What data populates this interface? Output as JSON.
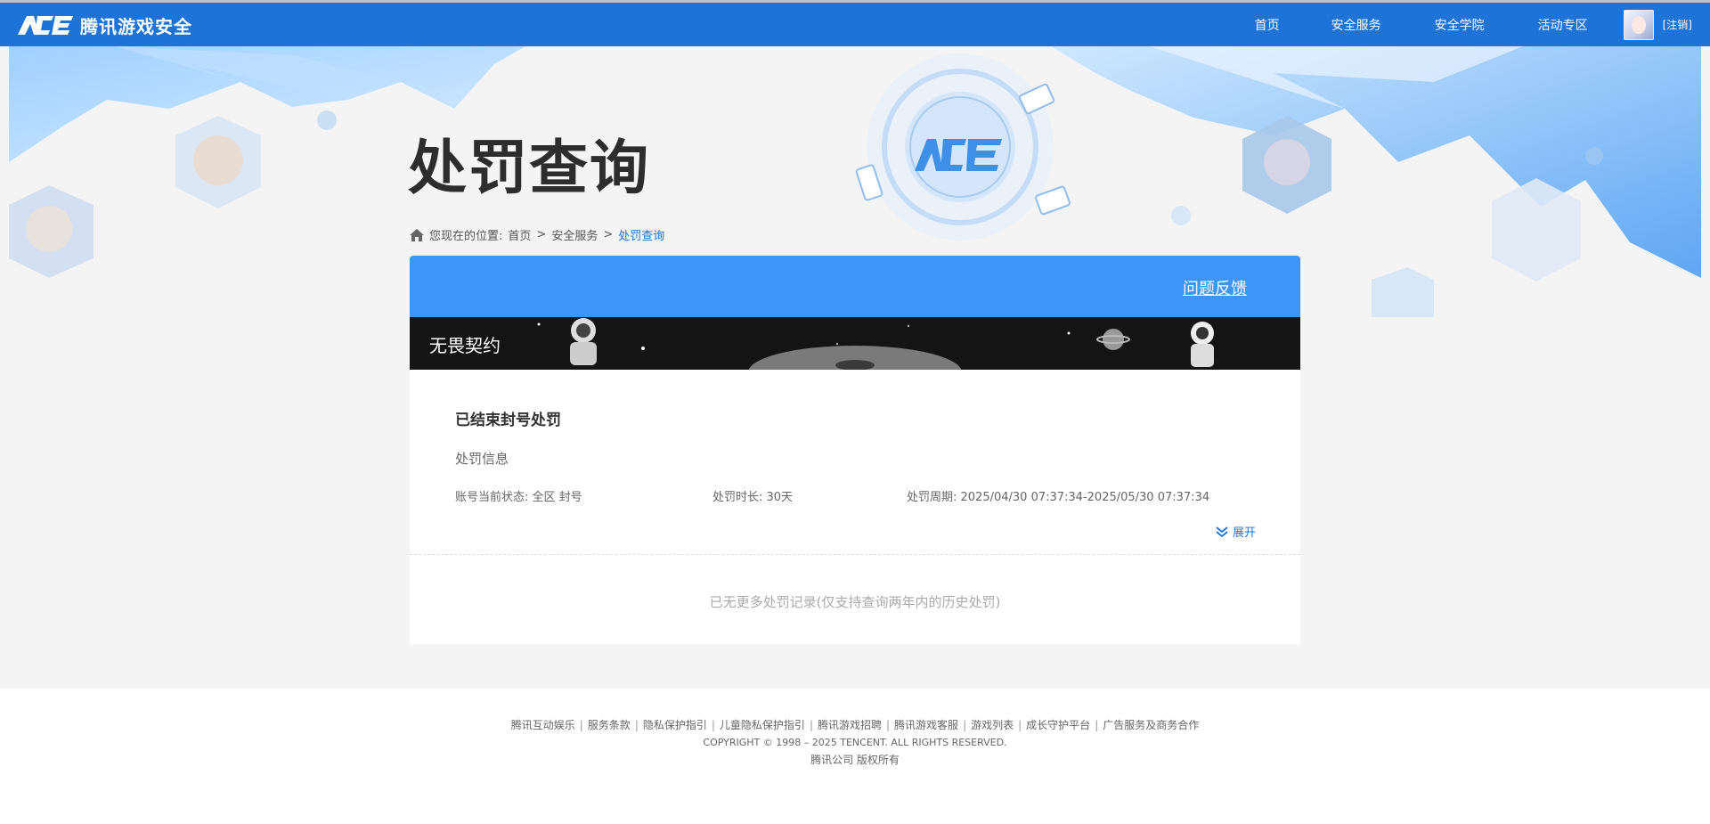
{
  "header": {
    "logo_text": "腾讯游戏安全",
    "nav": [
      "首页",
      "安全服务",
      "安全学院",
      "活动专区"
    ],
    "logout": "[注销]"
  },
  "page_title": "处罚查询",
  "breadcrumb": {
    "prefix": "您现在的位置:",
    "items": [
      "首页",
      "安全服务",
      "处罚查询"
    ],
    "separator": ">"
  },
  "panel": {
    "feedback": "问题反馈",
    "season_title": "无畏契约",
    "record": {
      "title": "已结束封号处罚",
      "subtitle": "处罚信息",
      "status": "账号当前状态: 全区 封号",
      "duration": "处罚时长: 30天",
      "period": "处罚周期: 2025/04/30 07:37:34-2025/05/30 07:37:34",
      "expand": "展开"
    },
    "no_more": "已无更多处罚记录(仅支持查询两年内的历史处罚)"
  },
  "footer": {
    "links": [
      "腾讯互动娱乐",
      "服务条款",
      "隐私保护指引",
      "儿童隐私保护指引",
      "腾讯游戏招聘",
      "腾讯游戏客服",
      "游戏列表",
      "成长守护平台",
      "广告服务及商务合作"
    ],
    "copyright": "COPYRIGHT © 1998 – 2025 TENCENT. ALL RIGHTS RESERVED.",
    "company": "腾讯公司 版权所有"
  },
  "colors": {
    "header_blue": "#1d73d8",
    "panel_head": "#3d96f7",
    "link_blue": "#1d73d8"
  }
}
